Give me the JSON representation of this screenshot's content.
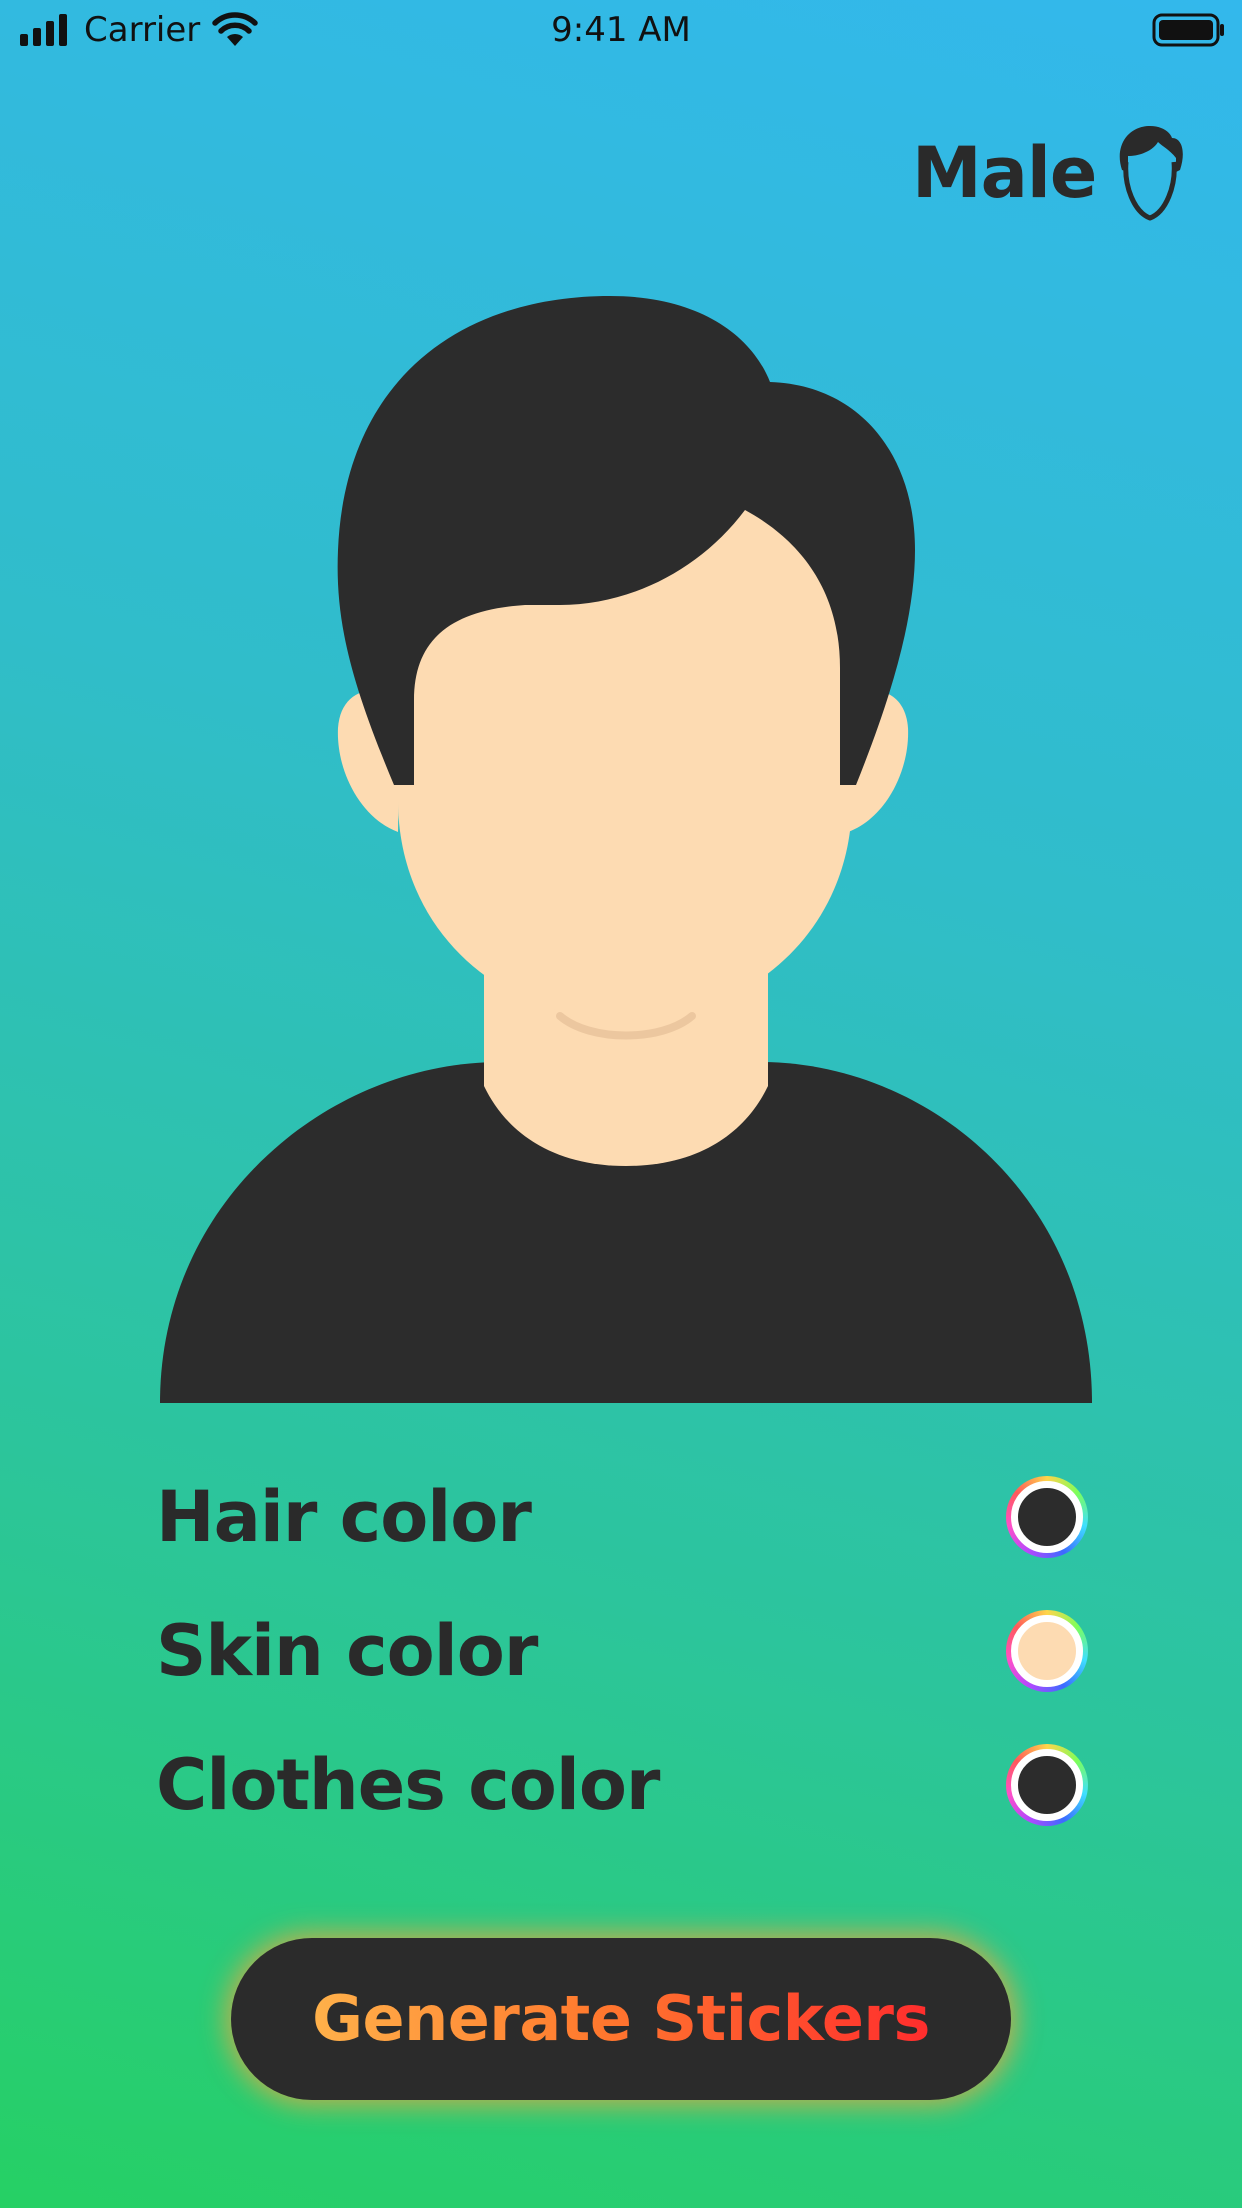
{
  "status_bar": {
    "carrier": "Carrier",
    "time": "9:41 AM"
  },
  "gender_toggle": {
    "label": "Male",
    "icon": "male-head-icon"
  },
  "avatar": {
    "hair_color": "#2c2c2c",
    "skin_color": "#fddbb2",
    "clothes_color": "#2c2c2c"
  },
  "color_options": [
    {
      "label": "Hair color",
      "value": "#2c2c2c"
    },
    {
      "label": "Skin color",
      "value": "#fddbb2"
    },
    {
      "label": "Clothes color",
      "value": "#2c2c2c"
    }
  ],
  "generate_button": {
    "label": "Generate Stickers"
  },
  "colors": {
    "text_dark": "#2a2a2a",
    "button_bg": "#2b2b2b",
    "button_text_start": "#ffb14a",
    "button_text_end": "#ff2d2d"
  }
}
